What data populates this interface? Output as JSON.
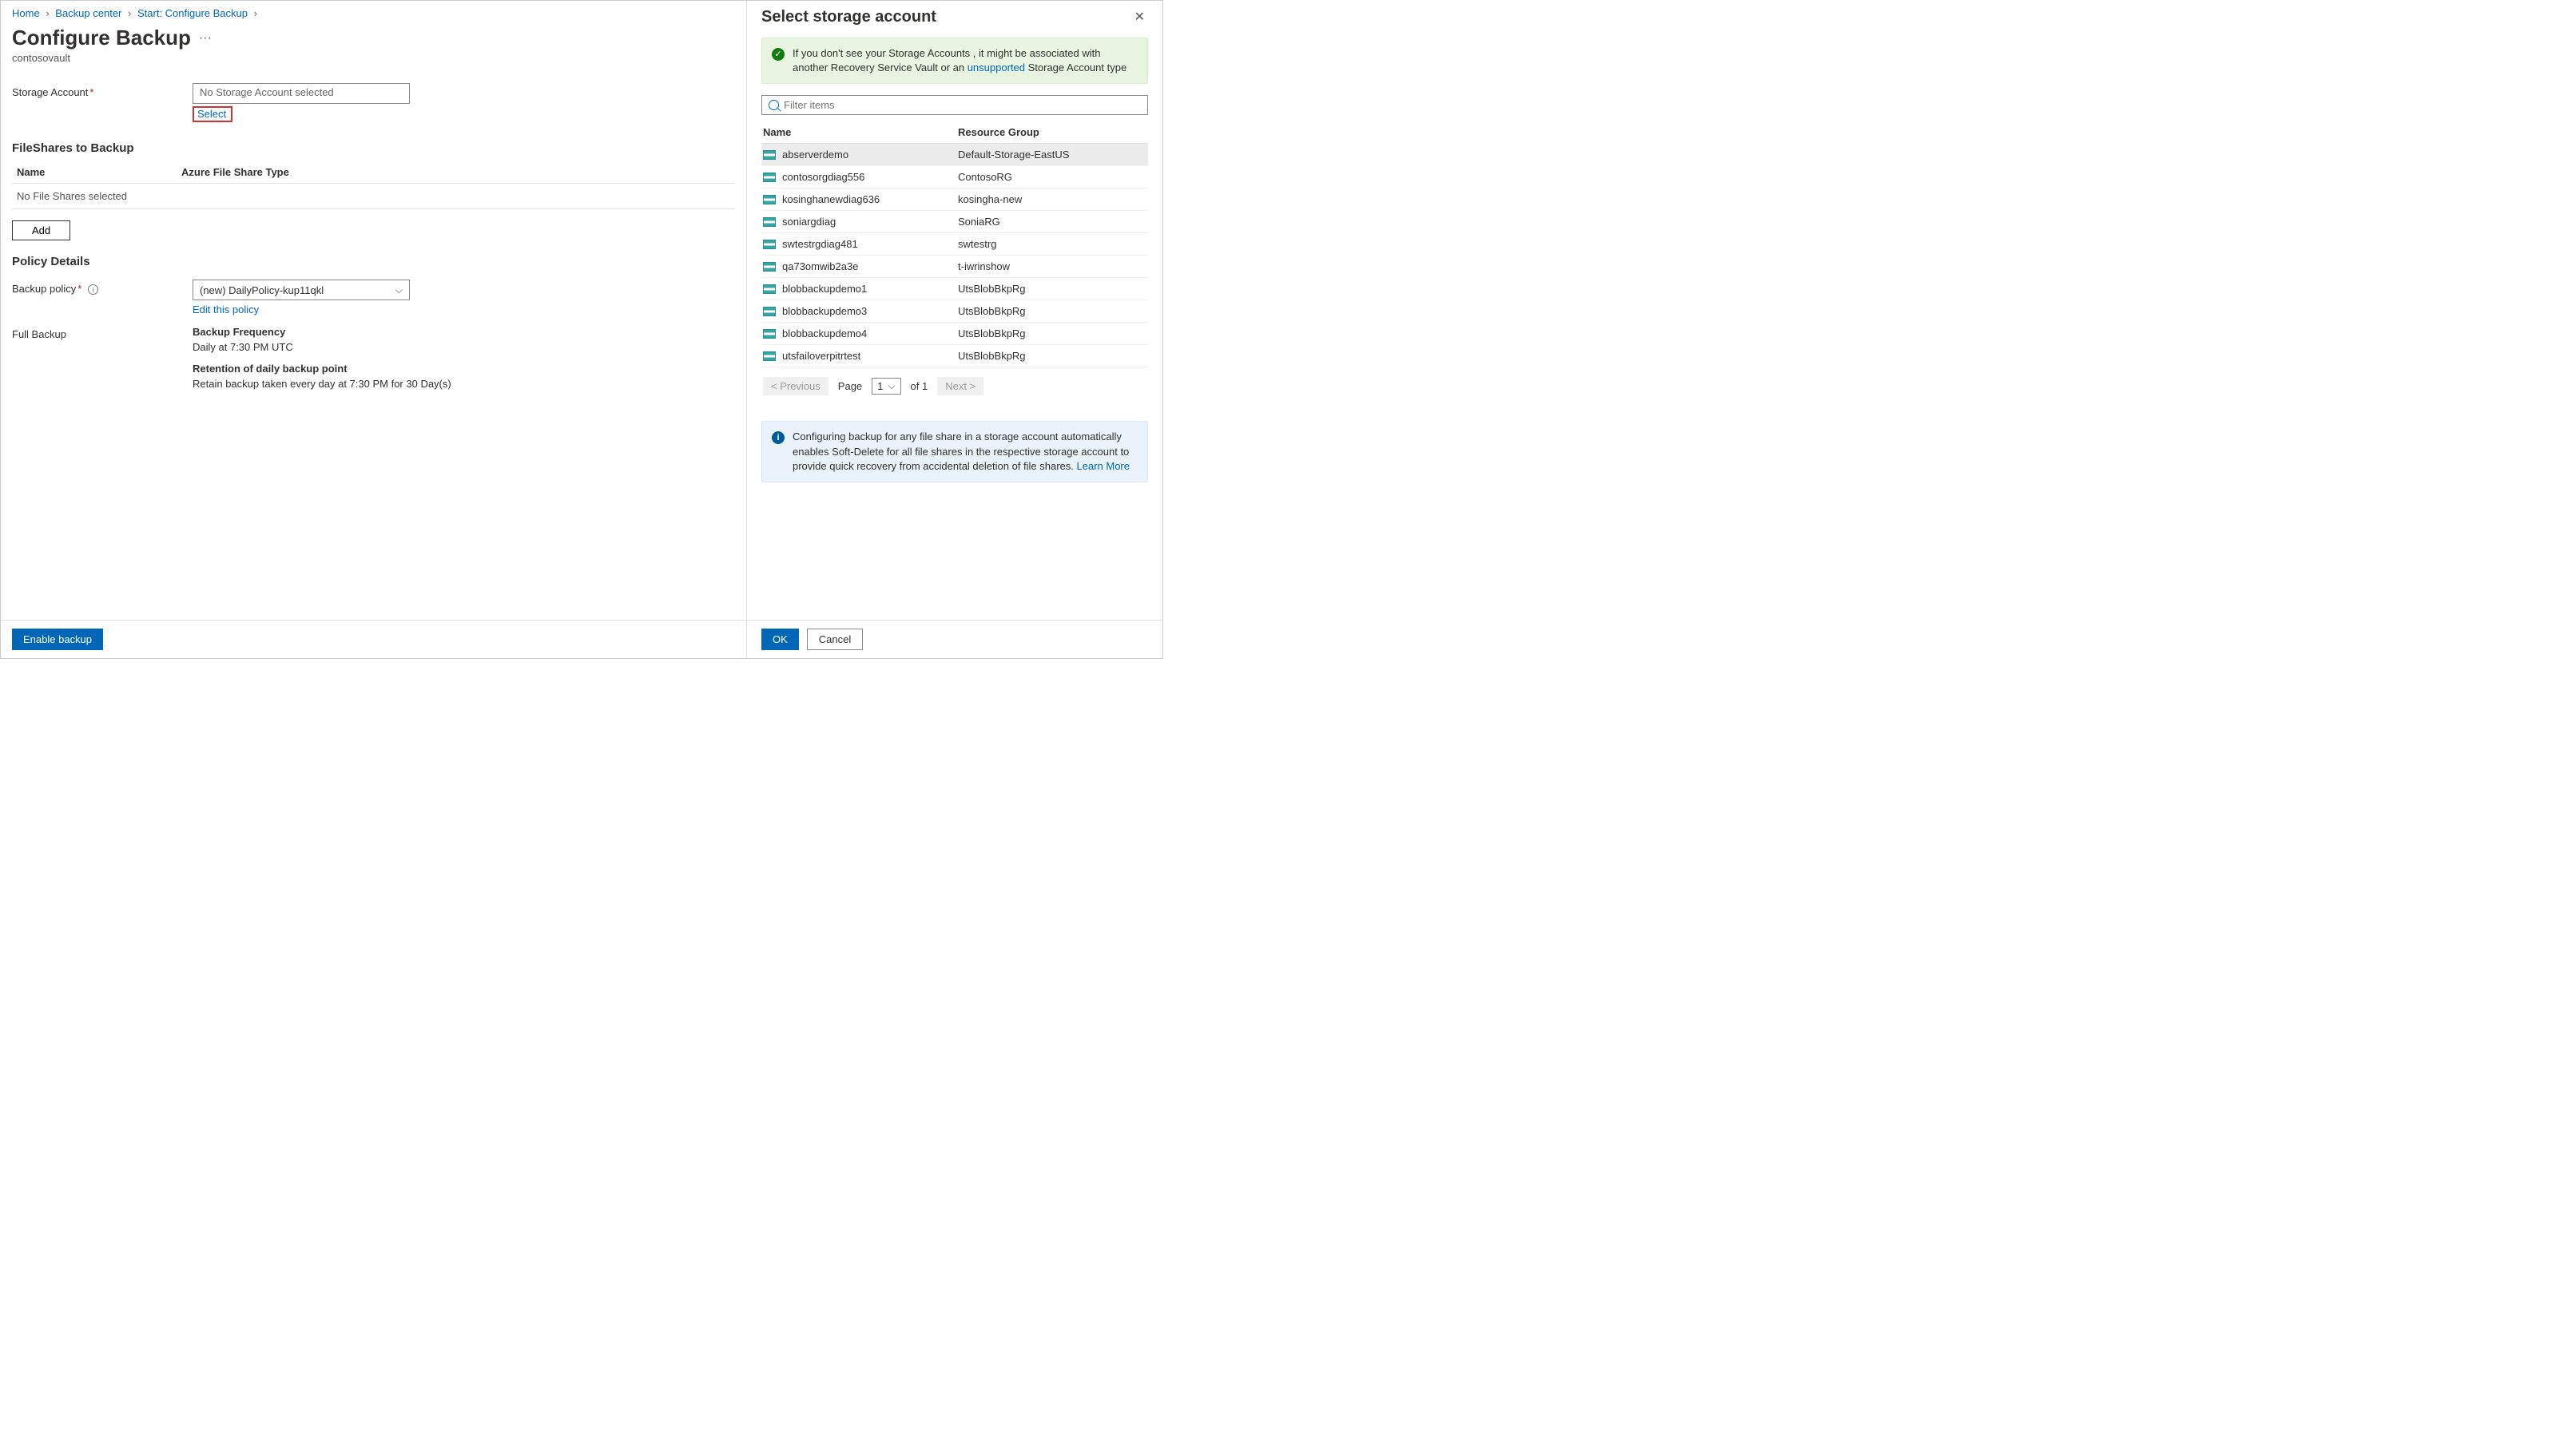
{
  "breadcrumb": {
    "items": [
      "Home",
      "Backup center",
      "Start: Configure Backup"
    ]
  },
  "page": {
    "title": "Configure Backup",
    "subtitle": "contosovault"
  },
  "storageAccount": {
    "label": "Storage Account",
    "value": "No Storage Account selected",
    "selectLink": "Select"
  },
  "fileShares": {
    "heading": "FileShares to Backup",
    "col1": "Name",
    "col2": "Azure File Share Type",
    "empty": "No File Shares selected",
    "addBtn": "Add"
  },
  "policyDetails": {
    "heading": "Policy Details",
    "backupPolicyLabel": "Backup policy",
    "backupPolicyValue": "(new) DailyPolicy-kup11qkl",
    "editLink": "Edit this policy",
    "fullBackupLabel": "Full Backup",
    "freqTitle": "Backup Frequency",
    "freqText": "Daily at 7:30 PM UTC",
    "retTitle": "Retention of daily backup point",
    "retText": "Retain backup taken every day at 7:30 PM for 30 Day(s)"
  },
  "footer": {
    "enableBtn": "Enable backup"
  },
  "panel": {
    "title": "Select storage account",
    "infoGreen1": "If you don't see your Storage Accounts , it might be associated with another Recovery Service Vault or an ",
    "infoGreenLink": "unsupported",
    "infoGreen2": " Storage Account type",
    "searchPlaceholder": "Filter items",
    "colName": "Name",
    "colRg": "Resource Group",
    "rows": [
      {
        "name": "abserverdemo",
        "rg": "Default-Storage-EastUS",
        "selected": true
      },
      {
        "name": "contosorgdiag556",
        "rg": "ContosoRG"
      },
      {
        "name": "kosinghanewdiag636",
        "rg": "kosingha-new"
      },
      {
        "name": "soniargdiag",
        "rg": "SoniaRG"
      },
      {
        "name": "swtestrgdiag481",
        "rg": "swtestrg"
      },
      {
        "name": "qa73omwib2a3e",
        "rg": "t-iwrinshow"
      },
      {
        "name": "blobbackupdemo1",
        "rg": "UtsBlobBkpRg"
      },
      {
        "name": "blobbackupdemo3",
        "rg": "UtsBlobBkpRg"
      },
      {
        "name": "blobbackupdemo4",
        "rg": "UtsBlobBkpRg"
      },
      {
        "name": "utsfailoverpitrtest",
        "rg": "UtsBlobBkpRg"
      }
    ],
    "pager": {
      "prev": "< Previous",
      "pageLabel": "Page",
      "pageNum": "1",
      "of": "of 1",
      "next": "Next >"
    },
    "infoBlue": "Configuring backup for any file share in a storage account automatically enables Soft-Delete for all file shares in the respective storage account to provide quick recovery from accidental deletion of file shares.  ",
    "infoBlueLink": "Learn More",
    "okBtn": "OK",
    "cancelBtn": "Cancel"
  }
}
